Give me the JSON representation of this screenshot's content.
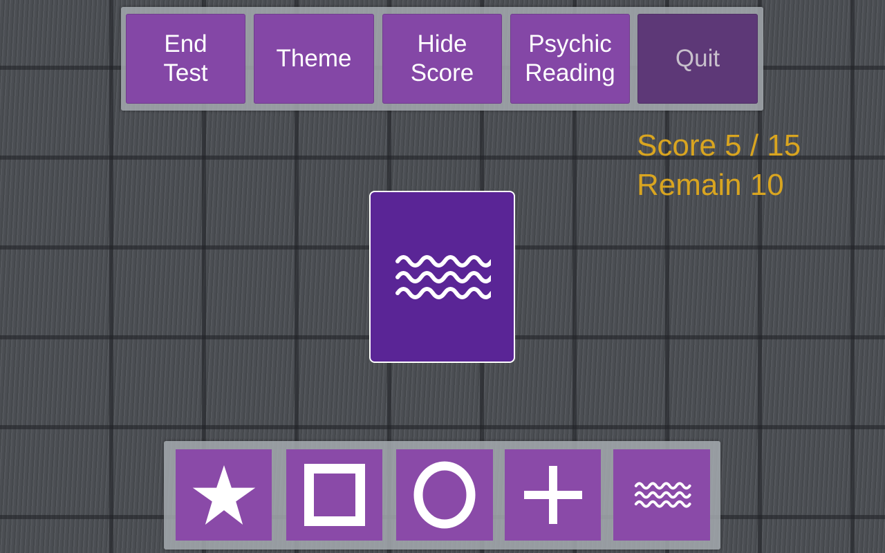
{
  "toolbar": {
    "buttons": [
      {
        "label": "End\nTest"
      },
      {
        "label": "Theme"
      },
      {
        "label": "Hide\nScore"
      },
      {
        "label": "Psychic\nReading"
      },
      {
        "label": "Quit"
      }
    ]
  },
  "score": {
    "score_text": "Score 5 / 15",
    "remain_text": "Remain 10"
  },
  "current_card": {
    "symbol": "waves-icon"
  },
  "choices": [
    {
      "symbol": "star-icon"
    },
    {
      "symbol": "square-icon"
    },
    {
      "symbol": "circle-icon"
    },
    {
      "symbol": "plus-icon"
    },
    {
      "symbol": "waves-icon"
    }
  ],
  "colors": {
    "button": "#8447a6",
    "quit_button": "#5d3877",
    "card": "#5a2596",
    "choice": "#8a4aa8",
    "score_text": "#d9a520"
  }
}
